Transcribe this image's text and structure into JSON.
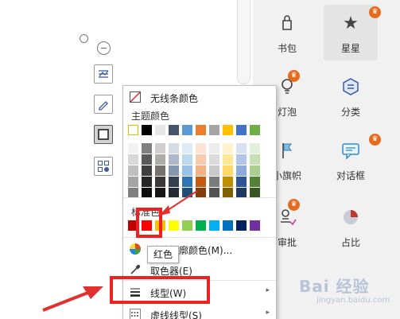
{
  "menu": {
    "no_line_label": "无线条颜色",
    "theme_label": "主题颜色",
    "standard_label": "标准色",
    "other_label": "其他轮廓颜色(M)...",
    "eyedropper_label": "取色器(E)",
    "line_type_label": "线型(W)",
    "dash_type_label": "虚线线型(S)",
    "tooltip": "红色"
  },
  "theme_row": [
    "#ffffff",
    "#000000",
    "#e7e6e6",
    "#44546a",
    "#5b9bd5",
    "#ed7d31",
    "#a5a5a5",
    "#ffc000",
    "#4472c4",
    "#70ad47"
  ],
  "theme_shades": [
    [
      "#f2f2f2",
      "#7f7f7f",
      "#d0cece",
      "#d6dce4",
      "#ddebf7",
      "#fbe4d5",
      "#ededed",
      "#fff2cc",
      "#d9e2f3",
      "#e2efda"
    ],
    [
      "#d8d8d8",
      "#595959",
      "#aeabab",
      "#adb9ca",
      "#bdd7ee",
      "#f8cbad",
      "#dbdbdb",
      "#ffe699",
      "#b4c6e7",
      "#c6e0b4"
    ],
    [
      "#bfbfbf",
      "#3f3f3f",
      "#757171",
      "#8497b0",
      "#9bc2e6",
      "#f4b183",
      "#c9c9c9",
      "#ffd966",
      "#8eaadb",
      "#a9d08e"
    ],
    [
      "#a5a5a5",
      "#262626",
      "#3a3838",
      "#333f4f",
      "#2e75b6",
      "#c55a11",
      "#7b7b7b",
      "#bf8f00",
      "#2f5597",
      "#538135"
    ],
    [
      "#7f7f7f",
      "#0c0c0c",
      "#171616",
      "#222a35",
      "#1f4e79",
      "#833c0b",
      "#525252",
      "#7f6000",
      "#1f3864",
      "#375623"
    ]
  ],
  "standard_colors": [
    "#c00000",
    "#ff0000",
    "#ffc000",
    "#ffff00",
    "#92d050",
    "#00b050",
    "#00b0f0",
    "#0070c0",
    "#002060",
    "#7030a0"
  ],
  "tiles": [
    {
      "name": "tile-bookbag",
      "label": "书包",
      "icon": "bag-icon"
    },
    {
      "name": "tile-star",
      "label": "星星",
      "icon": "star-icon"
    },
    {
      "name": "tile-bulb",
      "label": "灯泡",
      "icon": "bulb-icon"
    },
    {
      "name": "tile-category",
      "label": "分类",
      "icon": "category-icon"
    },
    {
      "name": "tile-flag",
      "label": "小旗帜",
      "icon": "flag-icon"
    },
    {
      "name": "tile-dialog",
      "label": "对话框",
      "icon": "dialog-icon"
    },
    {
      "name": "tile-approve",
      "label": "审批",
      "icon": "approve-icon"
    },
    {
      "name": "tile-ratio",
      "label": "占比",
      "icon": "pie-icon"
    }
  ],
  "watermark": {
    "text": "Bai 经验",
    "sub": "jingyan.baidu.com"
  },
  "colors": {
    "highlight": "#ee2020",
    "badge": "#e56a1d",
    "arrow": "#e03030"
  }
}
